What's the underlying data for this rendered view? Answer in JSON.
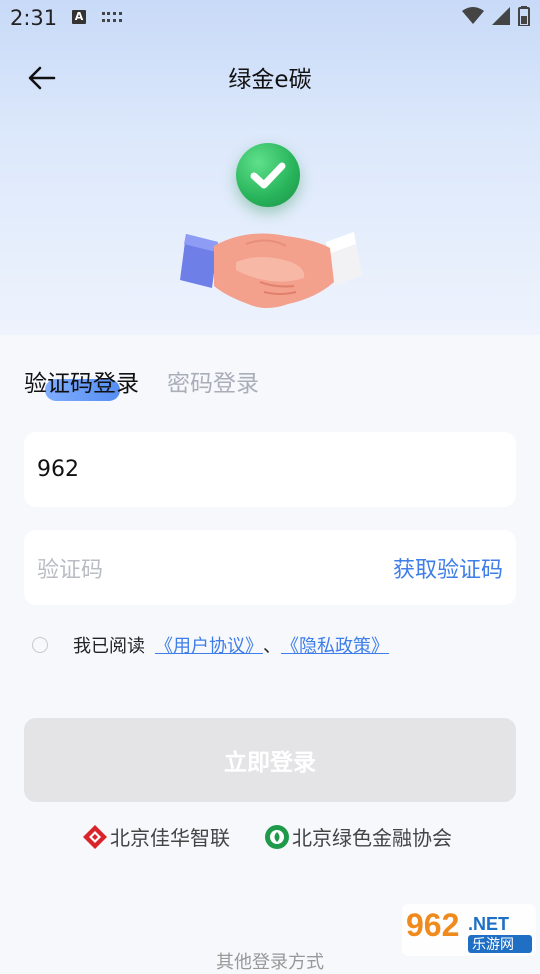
{
  "status_bar": {
    "time": "2:31",
    "a_badge": "A",
    "icons": [
      "keyboard-icon",
      "wifi-icon",
      "signal-icon",
      "battery-icon"
    ]
  },
  "header": {
    "title": "绿金e碳",
    "back_icon": "arrow-left-icon"
  },
  "hero": {
    "icons": [
      "check-circle-icon",
      "handshake-illustration"
    ]
  },
  "tabs": {
    "active": "验证码登录",
    "inactive": "密码登录"
  },
  "form": {
    "phone_value": "962",
    "code_placeholder": "验证码",
    "get_code_label": "获取验证码"
  },
  "agreement": {
    "prefix": "我已阅读",
    "user_agreement": "《用户协议》",
    "separator": "、",
    "privacy_policy": "《隐私政策》",
    "checked": false
  },
  "login_button": "立即登录",
  "partners": [
    {
      "name": "北京佳华智联",
      "icon": "jiahua-logo-icon"
    },
    {
      "name": "北京绿色金融协会",
      "icon": "green-finance-logo-icon"
    }
  ],
  "footer": {
    "other_login": "其他登录方式"
  },
  "watermark": {
    "number": "962",
    "net": ".NET",
    "site": "乐游网"
  },
  "colors": {
    "accent": "#3f7ee8",
    "hero_gradient_top": "#c8daf8",
    "background": "#f6f8fc",
    "button_disabled": "#e4e4e7",
    "check_green": "#27b35a"
  }
}
